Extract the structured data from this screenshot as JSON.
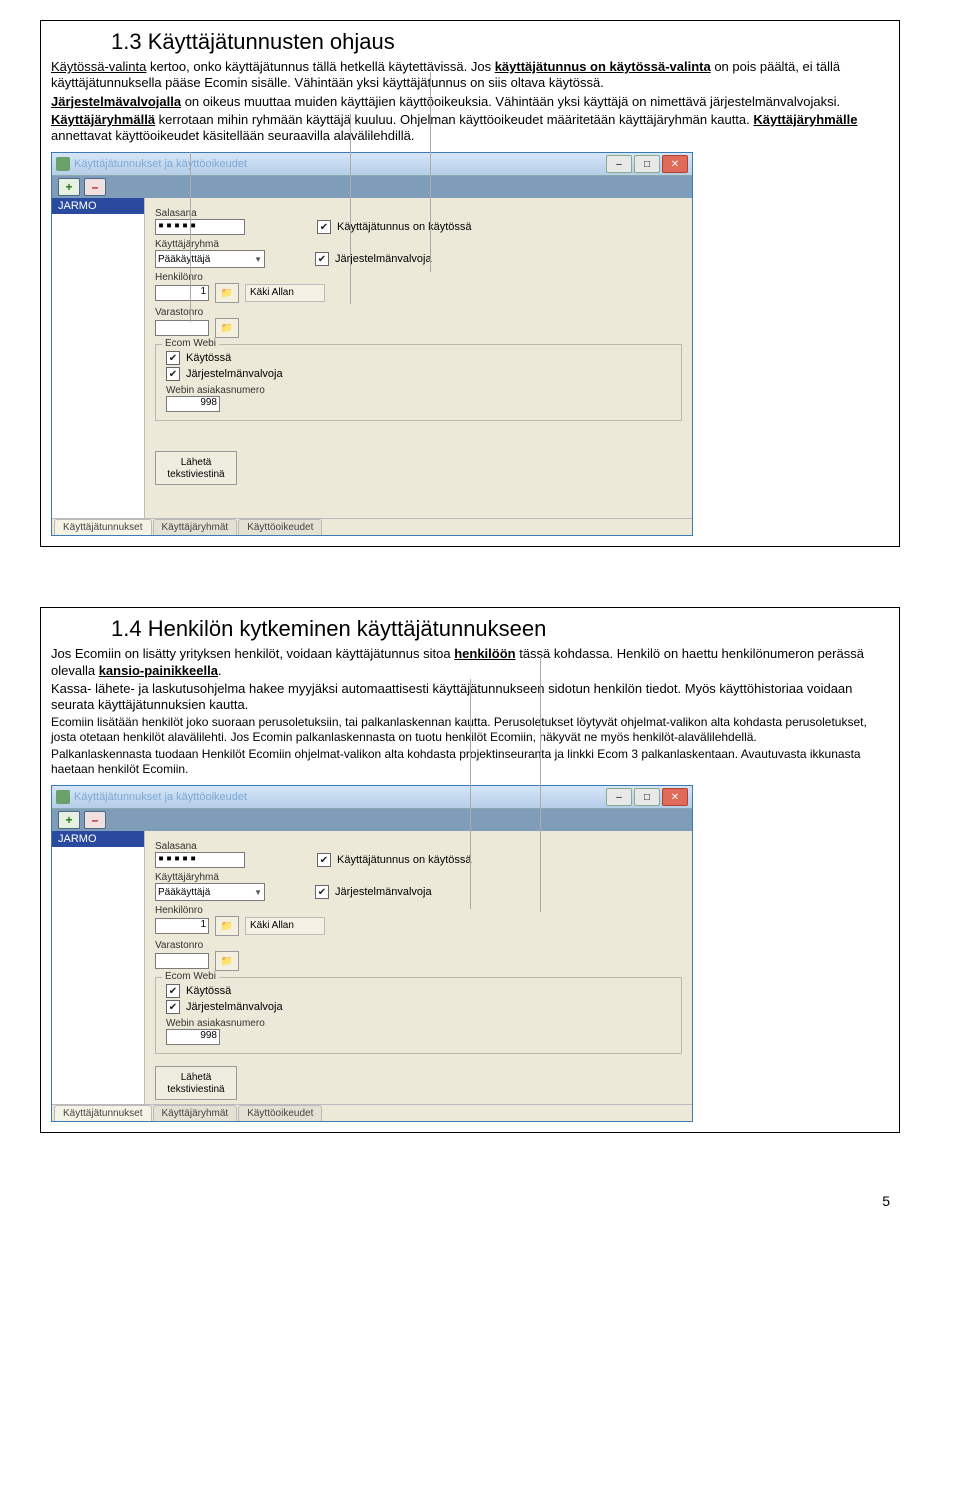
{
  "section1": {
    "title": "1.3 Käyttäjätunnusten ohjaus",
    "p1a": "Käytössä-valinta",
    "p1b": " kertoo, onko käyttäjätunnus tällä hetkellä käytettävissä. Jos ",
    "p1c": "käyttäjätunnus on käytössä-valinta",
    "p1d": " on pois päältä, ei tällä käyttäjätunnuksella pääse Ecomin sisälle. Vähintään yksi käyttäjätunnus on siis oltava käytössä.",
    "p2a": "Järjestelmävalvojalla",
    "p2b": " on oikeus muuttaa muiden käyttäjien käyttöoikeuksia. Vähintään yksi käyttäjä on nimettävä järjestelmänvalvojaksi.",
    "p3a": "Käyttäjäryhmällä",
    "p3b": " kerrotaan mihin ryhmään käyttäjä kuuluu. Ohjelman käyttöoikeudet määritetään käyttäjäryhmän kautta. ",
    "p3c": "Käyttäjäryhmälle",
    "p3d": " annettavat käyttöoikeudet käsitellään seuraavilla alavälilehdillä."
  },
  "section2": {
    "title": "1.4 Henkilön kytkeminen käyttäjätunnukseen",
    "p1": "Jos Ecomiin on lisätty yrityksen henkilöt, voidaan käyttäjätunnus sitoa ",
    "p1b": "henkilöön",
    "p1c": " tässä kohdassa. Henkilö on haettu henkilönumeron perässä olevalla ",
    "p1d": "kansio-painikkeella",
    "p1e": ".",
    "p2": "Kassa- lähete- ja laskutusohjelma hakee myyjäksi automaattisesti käyttäjätunnukseen sidotun henkilön tiedot. Myös käyttöhistoriaa voidaan seurata käyttäjätunnuksien kautta.",
    "p3": "Ecomiin lisätään henkilöt joko suoraan perusoletuksiin, tai palkanlaskennan kautta. Perusoletukset löytyvät ohjelmat-valikon alta kohdasta perusoletukset, josta otetaan henkilöt alavälilehti. Jos Ecomin palkanlaskennasta on tuotu henkilöt Ecomiin, näkyvät ne myös henkilöt-alavälilehdellä.",
    "p4": "Palkanlaskennasta tuodaan Henkilöt Ecomiin ohjelmat-valikon alta kohdasta projektinseuranta ja linkki Ecom 3 palkanlaskentaan. Avautuvasta ikkunasta haetaan henkilöt Ecomiin."
  },
  "app": {
    "title": "Käyttäjätunnukset ja käyttöoikeudet",
    "selected": "JARMO",
    "labels": {
      "salasana": "Salasana",
      "kayttajaryhma": "Käyttäjäryhmä",
      "henkilonro": "Henkilönro",
      "varastonro": "Varastonro",
      "ecomwebi": "Ecom Webi",
      "webinasiakas": "Webin asiakasnumero"
    },
    "values": {
      "salasana": "▪▪▪▪▪",
      "ryhma": "Pääkäyttäjä",
      "henkilonro": "1",
      "henkilonimi": "Käki Allan",
      "webinno": "998"
    },
    "checkboxes": {
      "kaytossa": "Käyttäjätunnus on käytössä",
      "jvalvoja": "Järjestelmänvalvoja",
      "webikaytossa": "Käytössä",
      "webijvalvoja": "Järjestelmänvalvoja"
    },
    "sendbtn": "Lähetä tekstiviestinä",
    "tabs": [
      "Käyttäjätunnukset",
      "Käyttäjäryhmät",
      "Käyttöoikeudet"
    ]
  },
  "pagenum": "5"
}
